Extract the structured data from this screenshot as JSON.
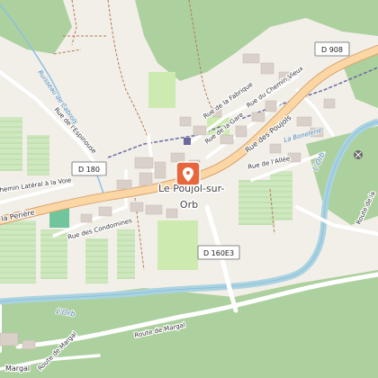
{
  "map": {
    "town": {
      "line1": "Le Poujol-sur-",
      "line2": "Orb"
    },
    "roads": {
      "d908": "D 908",
      "d180": "D 180",
      "d160e3": "D 160E3",
      "rue_des_poujols": "Rue des Poujols",
      "rue_du_chemin_vieux": "Rue du Chemin Vieux",
      "rue_de_la_gare": "Rue de la Gare",
      "rue_de_la_fabrique": "Rue de la Fabrique",
      "rue_de_l_allee": "Rue de l'Allée",
      "rue_de_l_espinouse": "Rue de l'Espinouse",
      "chemin_lateral": "Chemin Latéral à la Voie",
      "la_periere": "la Perière",
      "rue_des_condomines": "Rue des Condomines",
      "route_de_margal": "Route de Margal",
      "route_de_margal_2": "Route de Margal",
      "route_de_la": "Route de la",
      "margal": "Margal",
      "la_bonnelerie": "La Bonelerie"
    },
    "water": {
      "ruisseau": "Ruisseau de Cabrols",
      "orb_1": "L'Orb",
      "orb_2": "L'Orb"
    },
    "colors": {
      "background": "#f2efe9",
      "forest": "#add19e",
      "vineyard": "#c7e3b6",
      "meadow": "#cdebb0",
      "water": "#aad3df",
      "river_line": "#8dbfe2",
      "main_road": "#fcd6a4",
      "main_road_casing": "#d7a46f",
      "minor_road": "#ffffff",
      "building": "#d9d0c9",
      "marker": "#e8663d"
    },
    "icons": [
      "location-pin-icon",
      "railway-station-icon",
      "mine-icon"
    ]
  }
}
